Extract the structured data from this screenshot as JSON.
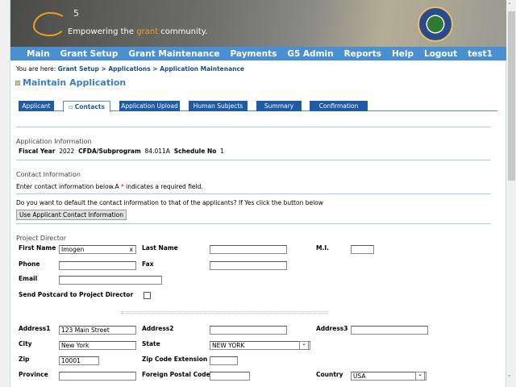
{
  "banner": {
    "logo_mark": "G5",
    "tagline_pre": "Empowering the ",
    "tagline_accent": "grant",
    "tagline_post": " community.",
    "accent_color": "#f0a020"
  },
  "nav": [
    "Main",
    "Grant Setup",
    "Grant Maintenance",
    "Payments",
    "G5 Admin",
    "Reports",
    "Help",
    "Logout",
    "test1"
  ],
  "breadcrumb": {
    "prefix": "You are here: ",
    "path": "Grant Setup > Applications > Application Maintenance"
  },
  "page_title": "Maintain Application",
  "tabs": [
    "Applicant",
    "Contacts",
    "Application Upload",
    "Human Subjects",
    "Summary",
    "Confirmation"
  ],
  "active_tab": "Contacts",
  "app_info": {
    "heading": "Application Information",
    "fy_label": "Fiscal Year",
    "fy": "2022",
    "cfda_label": "CFDA/Subprogram",
    "cfda": "84.011A",
    "sched_label": "Schedule No",
    "sched": "1"
  },
  "contact": {
    "heading": "Contact Information",
    "instructions": "Enter contact information below.A ",
    "required_mark": "*",
    "instructions2": " indicates a required field.",
    "default_q": "Do you want to default the contact information to that of the applicants? If Yes click the button below",
    "default_button": "Use Applicant Contact Information"
  },
  "director": {
    "heading": "Project Director",
    "first_name_label": "First Name",
    "first_name": "Imogen",
    "clear": "x",
    "last_name_label": "Last Name",
    "last_name": "",
    "mi_label": "M.I.",
    "mi": "",
    "phone_label": "Phone",
    "phone": "",
    "fax_label": "Fax",
    "fax": "",
    "email_label": "Email",
    "email": "",
    "postcard_label": "Send Postcard to Project Director",
    "address1_label": "Address1",
    "address1": "123 Main Street",
    "address2_label": "Address2",
    "address2": "",
    "address3_label": "Address3",
    "address3": "",
    "city_label": "City",
    "city": "New York",
    "state_label": "State",
    "state": "NEW YORK",
    "zip_label": "Zip",
    "zip": "10001",
    "zipext_label": "Zip Code Extension",
    "zipext": "",
    "province_label": "Province",
    "province": "",
    "postal_label": "Foreign Postal Code",
    "postal": "",
    "country_label": "Country",
    "country": "USA"
  }
}
